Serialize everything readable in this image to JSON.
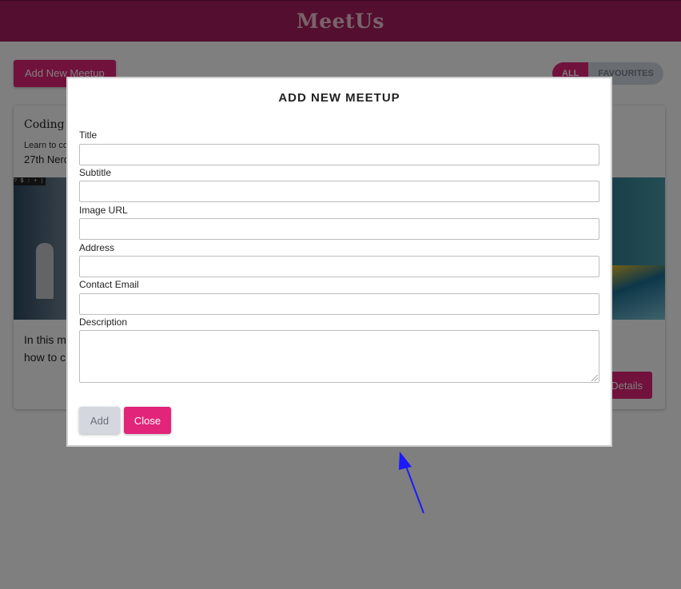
{
  "app": {
    "title": "MeetUs"
  },
  "toolbar": {
    "add_label": "Add New Meetup"
  },
  "filter": {
    "all_label": "ALL",
    "favourites_label": "FAVOURITES"
  },
  "card": {
    "title": "Coding E",
    "subtitle": "Learn to co",
    "address": "27th Nerd",
    "description_line1": "In this m",
    "description_line2": "how to c",
    "details_label": "Details"
  },
  "modal": {
    "title": "ADD NEW MEETUP",
    "fields": [
      {
        "label": "Title",
        "value": ""
      },
      {
        "label": "Subtitle",
        "value": ""
      },
      {
        "label": "Image URL",
        "value": ""
      },
      {
        "label": "Address",
        "value": ""
      },
      {
        "label": "Contact Email",
        "value": ""
      },
      {
        "label": "Description",
        "value": ""
      }
    ],
    "add_label": "Add",
    "close_label": "Close"
  },
  "colors": {
    "header": "#a91d5e",
    "accent": "#e2247a",
    "disabled": "#d4d7de",
    "arrow": "#1a1aff"
  },
  "icons": {
    "annotation": "arrow-icon",
    "resize": "resize-grip-icon"
  }
}
